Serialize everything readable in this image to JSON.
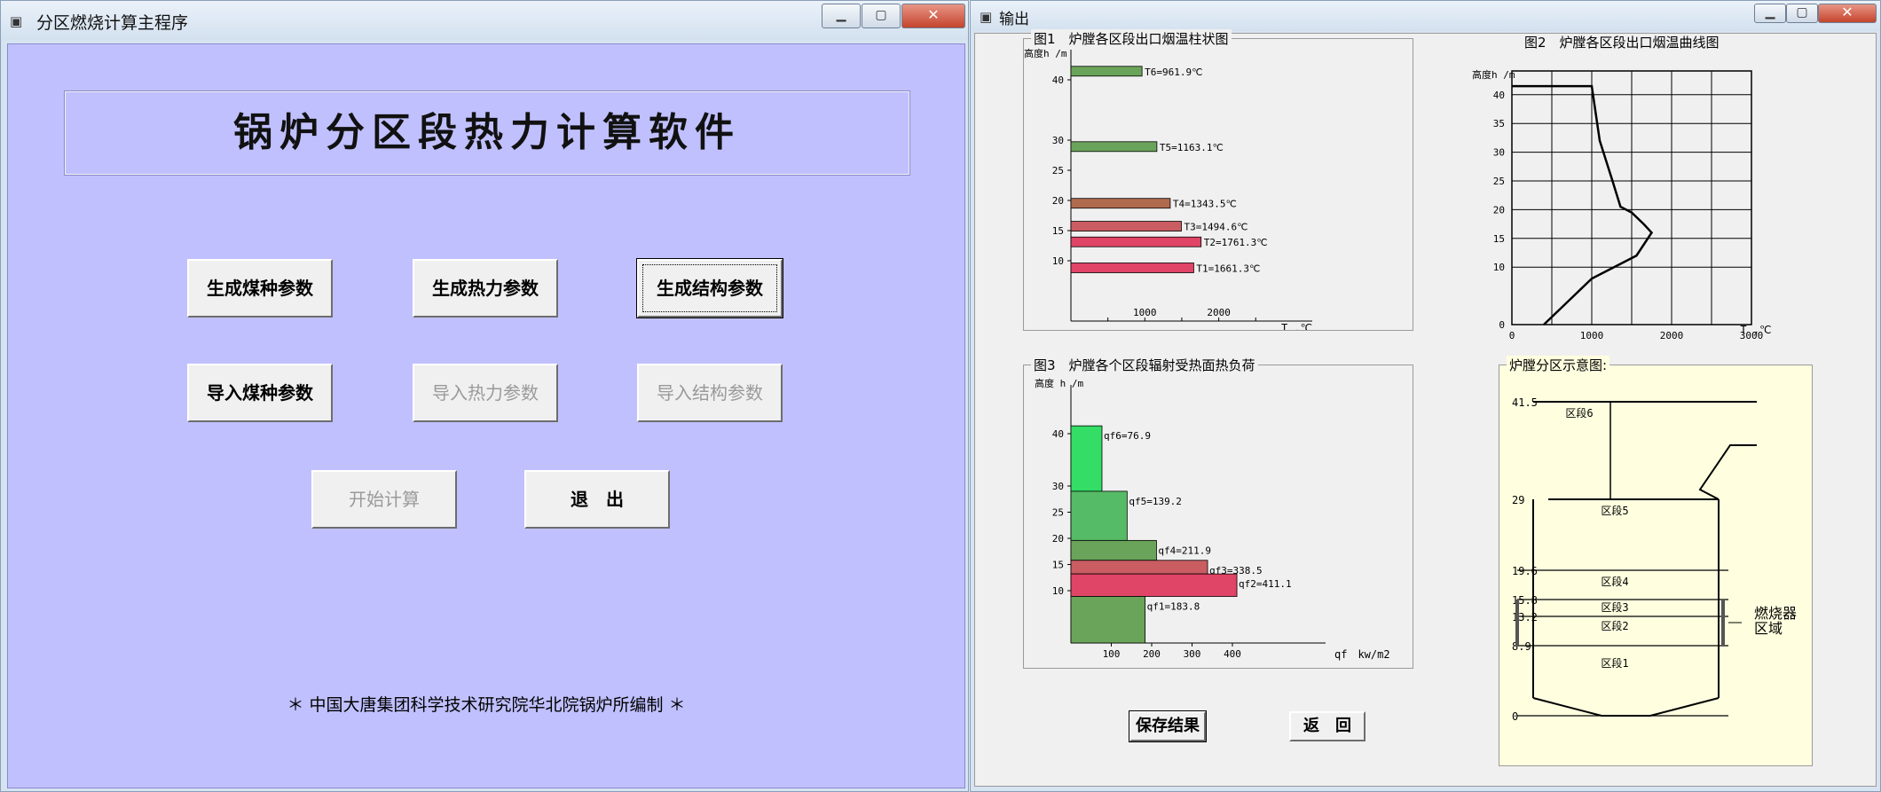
{
  "main_window": {
    "title": "分区燃烧计算主程序",
    "heading": "锅炉分区段热力计算软件",
    "buttons": {
      "gen_coal": "生成煤种参数",
      "gen_thermal": "生成热力参数",
      "gen_struct": "生成结构参数",
      "imp_coal": "导入煤种参数",
      "imp_thermal": "导入热力参数",
      "imp_struct": "导入结构参数",
      "start": "开始计算",
      "exit": "退　出"
    },
    "credit": "＊ 中国大唐集团科学技术研究院华北院锅炉所编制 ＊"
  },
  "output_window": {
    "title": "输出",
    "save_label": "保存结果",
    "back_label": "返　回"
  },
  "window_controls": {
    "minimize": "▁",
    "maximize": "▢",
    "close": "✕"
  },
  "chart_data": [
    {
      "type": "bar",
      "title": "图1　炉膛各区段出口烟温柱状图",
      "ylabel": "高度h /m",
      "xlabel": "T ,℃",
      "ylim": [
        0,
        43
      ],
      "xlim": [
        0,
        3000
      ],
      "xticks": [
        "1000",
        "2000"
      ],
      "yticks": [
        "10",
        "15",
        "20",
        "25",
        "30",
        "40"
      ],
      "bars": [
        {
          "label": "T6=961.9℃",
          "y": 41.5,
          "value": 961.9,
          "color": "#6aa45a"
        },
        {
          "label": "T5=1163.1℃",
          "y": 29.0,
          "value": 1163.1,
          "color": "#6aa45a"
        },
        {
          "label": "T4=1343.5℃",
          "y": 19.6,
          "value": 1343.5,
          "color": "#b06a4e"
        },
        {
          "label": "T3=1494.6℃",
          "y": 15.8,
          "value": 1494.6,
          "color": "#c95d62"
        },
        {
          "label": "T2=1761.3℃",
          "y": 13.2,
          "value": 1761.3,
          "color": "#e04466"
        },
        {
          "label": "T1=1661.3℃",
          "y": 8.9,
          "value": 1661.3,
          "color": "#e04466"
        }
      ]
    },
    {
      "type": "line",
      "title": "图2　炉膛各区段出口烟温曲线图",
      "ylabel": "高度h /m",
      "xlabel": "T ,℃",
      "xlim": [
        0,
        3000
      ],
      "ylim": [
        0,
        45
      ],
      "grid": true,
      "xticks": [
        "0",
        "1000",
        "2000",
        "3000"
      ],
      "yticks": [
        "0",
        "10",
        "15",
        "20",
        "25",
        "30",
        "35",
        "40"
      ],
      "x": [
        400,
        1000,
        1560,
        1750,
        1650,
        1500,
        1360,
        1260,
        1100,
        1000,
        0
      ],
      "y": [
        0,
        8,
        12,
        16,
        17.5,
        19.5,
        20.5,
        25,
        32,
        41.5,
        41.5
      ]
    },
    {
      "type": "bar",
      "title": "图3　炉膛各个区段辐射受热面热负荷",
      "ylabel": "高度 h /m",
      "xlabel": "qf　kw/m2",
      "ylim": [
        0,
        43
      ],
      "xlim": [
        0,
        480
      ],
      "xticks": [
        "100",
        "200",
        "300",
        "400"
      ],
      "yticks": [
        "10",
        "15",
        "20",
        "25",
        "30",
        "40"
      ],
      "bars": [
        {
          "label": "qf6=76.9",
          "y0": 29.0,
          "y1": 41.5,
          "value": 76.9,
          "color": "#33dd66"
        },
        {
          "label": "qf5=139.2",
          "y0": 19.6,
          "y1": 29.0,
          "value": 139.2,
          "color": "#55bb66"
        },
        {
          "label": "qf4=211.9",
          "y0": 15.8,
          "y1": 19.6,
          "value": 211.9,
          "color": "#6aa45a"
        },
        {
          "label": "qf3=338.5",
          "y0": 13.2,
          "y1": 15.8,
          "value": 338.5,
          "color": "#c95d62"
        },
        {
          "label": "qf2=411.1",
          "y0": 8.9,
          "y1": 13.2,
          "value": 411.1,
          "color": "#e04466"
        },
        {
          "label": "qf1=183.8",
          "y0": 0,
          "y1": 8.9,
          "value": 183.8,
          "color": "#6aa45a"
        }
      ]
    }
  ],
  "furnace_diagram": {
    "title": "炉膛分区示意图:",
    "levels": [
      "41.5",
      "29",
      "19.6",
      "15.8",
      "13.2",
      "8.9",
      "0"
    ],
    "zones": [
      "区段6",
      "区段5",
      "区段4",
      "区段3",
      "区段2",
      "区段1"
    ],
    "burner_label_1": "燃烧器",
    "burner_label_2": "区域"
  }
}
